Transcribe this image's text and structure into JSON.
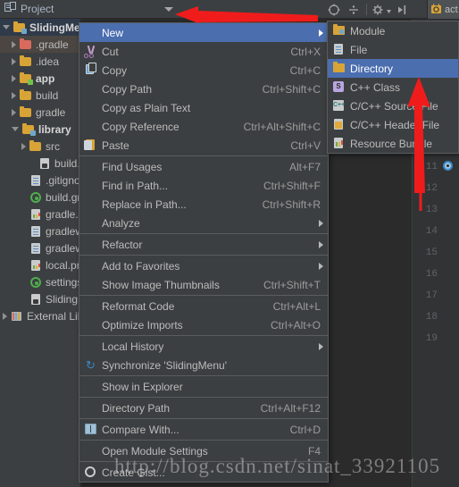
{
  "toolbar": {
    "panel_title": "Project",
    "panel_icon": "project-panel-icon",
    "dropdown_icon": "chevron-down-icon",
    "buttons": [
      {
        "name": "locate-icon",
        "glyph": "⊕"
      },
      {
        "name": "collapse-all-icon",
        "glyph": "÷"
      },
      {
        "name": "settings-gear-icon",
        "glyph": "⚙"
      },
      {
        "name": "hide-panel-icon",
        "glyph": "⇥"
      }
    ],
    "tab_label": "act"
  },
  "tree": {
    "items": [
      {
        "label": "SlidingMenu",
        "icon": "module-folder-icon",
        "twisty": "open",
        "indent": 0,
        "bold": true,
        "state": "selected"
      },
      {
        "label": ".gradle",
        "icon": "folder-red-icon",
        "twisty": "closed",
        "indent": 1,
        "bold": false,
        "state": "hover"
      },
      {
        "label": ".idea",
        "icon": "folder-orange-icon",
        "twisty": "closed",
        "indent": 1,
        "bold": false,
        "state": "none"
      },
      {
        "label": "app",
        "icon": "android-module-icon",
        "twisty": "closed",
        "indent": 1,
        "bold": true,
        "state": "none"
      },
      {
        "label": "build",
        "icon": "folder-orange-icon",
        "twisty": "closed",
        "indent": 1,
        "bold": false,
        "state": "none"
      },
      {
        "label": "gradle",
        "icon": "folder-orange-icon",
        "twisty": "closed",
        "indent": 1,
        "bold": false,
        "state": "none"
      },
      {
        "label": "library",
        "icon": "module-folder-icon",
        "twisty": "open",
        "indent": 1,
        "bold": true,
        "state": "none"
      },
      {
        "label": "src",
        "icon": "folder-orange-icon",
        "twisty": "closed",
        "indent": 2,
        "bold": false,
        "state": "none"
      },
      {
        "label": "build.gradle",
        "icon": "file-gray-icon",
        "twisty": "none",
        "indent": 3,
        "bold": false,
        "state": "none"
      },
      {
        "label": ".gitignore",
        "icon": "file-text-icon",
        "twisty": "none",
        "indent": 2,
        "bold": false,
        "state": "none"
      },
      {
        "label": "build.gradle",
        "icon": "gradle-icon",
        "twisty": "none",
        "indent": 2,
        "bold": false,
        "state": "none"
      },
      {
        "label": "gradle.properties",
        "icon": "properties-icon",
        "twisty": "none",
        "indent": 2,
        "bold": false,
        "state": "none"
      },
      {
        "label": "gradlew",
        "icon": "file-text-icon",
        "twisty": "none",
        "indent": 2,
        "bold": false,
        "state": "none"
      },
      {
        "label": "gradlew.bat",
        "icon": "file-text-icon",
        "twisty": "none",
        "indent": 2,
        "bold": false,
        "state": "none"
      },
      {
        "label": "local.properties",
        "icon": "properties-icon",
        "twisty": "none",
        "indent": 2,
        "bold": false,
        "state": "none"
      },
      {
        "label": "settings.gradle",
        "icon": "gradle-icon",
        "twisty": "none",
        "indent": 2,
        "bold": false,
        "state": "none"
      },
      {
        "label": "SlidingMenu.iml",
        "icon": "file-gray-icon",
        "twisty": "none",
        "indent": 2,
        "bold": false,
        "state": "none"
      },
      {
        "label": "External Libraries",
        "icon": "libraries-icon",
        "twisty": "closed",
        "indent": 0,
        "bold": false,
        "state": "none"
      }
    ]
  },
  "editor": {
    "line_numbers": [
      "11",
      "12",
      "13",
      "14",
      "15",
      "16",
      "17",
      "18",
      "19"
    ],
    "breakpoint_icon": "breakpoint-icon"
  },
  "context_menu": {
    "items": [
      {
        "type": "item",
        "label": "New",
        "accel": "",
        "icon": "",
        "submenu": true,
        "selected": true,
        "mnemonic": "N"
      },
      {
        "type": "item",
        "label": "Cut",
        "accel": "Ctrl+X",
        "icon": "cut-icon",
        "submenu": false,
        "selected": false,
        "mnemonic": "t"
      },
      {
        "type": "item",
        "label": "Copy",
        "accel": "Ctrl+C",
        "icon": "copy-icon",
        "submenu": false,
        "selected": false,
        "mnemonic": "C"
      },
      {
        "type": "item",
        "label": "Copy Path",
        "accel": "Ctrl+Shift+C",
        "icon": "",
        "submenu": false,
        "selected": false,
        "mnemonic": "o"
      },
      {
        "type": "item",
        "label": "Copy as Plain Text",
        "accel": "",
        "icon": "",
        "submenu": false,
        "selected": false,
        "mnemonic": ""
      },
      {
        "type": "item",
        "label": "Copy Reference",
        "accel": "Ctrl+Alt+Shift+C",
        "icon": "",
        "submenu": false,
        "selected": false,
        "mnemonic": ""
      },
      {
        "type": "item",
        "label": "Paste",
        "accel": "Ctrl+V",
        "icon": "paste-icon",
        "submenu": false,
        "selected": false,
        "mnemonic": "P"
      },
      {
        "type": "sep"
      },
      {
        "type": "item",
        "label": "Find Usages",
        "accel": "Alt+F7",
        "icon": "",
        "submenu": false,
        "selected": false,
        "mnemonic": "U"
      },
      {
        "type": "item",
        "label": "Find in Path...",
        "accel": "Ctrl+Shift+F",
        "icon": "",
        "submenu": false,
        "selected": false,
        "mnemonic": "P"
      },
      {
        "type": "item",
        "label": "Replace in Path...",
        "accel": "Ctrl+Shift+R",
        "icon": "",
        "submenu": false,
        "selected": false,
        "mnemonic": "a"
      },
      {
        "type": "item",
        "label": "Analyze",
        "accel": "",
        "icon": "",
        "submenu": true,
        "selected": false,
        "mnemonic": "z"
      },
      {
        "type": "sep"
      },
      {
        "type": "item",
        "label": "Refactor",
        "accel": "",
        "icon": "",
        "submenu": true,
        "selected": false,
        "mnemonic": "R"
      },
      {
        "type": "sep"
      },
      {
        "type": "item",
        "label": "Add to Favorites",
        "accel": "",
        "icon": "",
        "submenu": true,
        "selected": false,
        "mnemonic": "F"
      },
      {
        "type": "item",
        "label": "Show Image Thumbnails",
        "accel": "Ctrl+Shift+T",
        "icon": "",
        "submenu": false,
        "selected": false,
        "mnemonic": ""
      },
      {
        "type": "sep"
      },
      {
        "type": "item",
        "label": "Reformat Code",
        "accel": "Ctrl+Alt+L",
        "icon": "",
        "submenu": false,
        "selected": false,
        "mnemonic": "R"
      },
      {
        "type": "item",
        "label": "Optimize Imports",
        "accel": "Ctrl+Alt+O",
        "icon": "",
        "submenu": false,
        "selected": false,
        "mnemonic": "z"
      },
      {
        "type": "sep"
      },
      {
        "type": "item",
        "label": "Local History",
        "accel": "",
        "icon": "",
        "submenu": true,
        "selected": false,
        "mnemonic": "H"
      },
      {
        "type": "item",
        "label": "Synchronize 'SlidingMenu'",
        "accel": "",
        "icon": "synchronize-icon",
        "submenu": false,
        "selected": false,
        "mnemonic": ""
      },
      {
        "type": "sep"
      },
      {
        "type": "item",
        "label": "Show in Explorer",
        "accel": "",
        "icon": "",
        "submenu": false,
        "selected": false,
        "mnemonic": ""
      },
      {
        "type": "sep"
      },
      {
        "type": "item",
        "label": "Directory Path",
        "accel": "Ctrl+Alt+F12",
        "icon": "",
        "submenu": false,
        "selected": false,
        "mnemonic": "P"
      },
      {
        "type": "sep"
      },
      {
        "type": "item",
        "label": "Compare With...",
        "accel": "Ctrl+D",
        "icon": "compare-icon",
        "submenu": false,
        "selected": false,
        "mnemonic": ""
      },
      {
        "type": "sep"
      },
      {
        "type": "item",
        "label": "Open Module Settings",
        "accel": "F4",
        "icon": "",
        "submenu": false,
        "selected": false,
        "mnemonic": ""
      },
      {
        "type": "sep"
      },
      {
        "type": "item",
        "label": "Create Gist...",
        "accel": "",
        "icon": "gist-icon",
        "submenu": false,
        "selected": false,
        "mnemonic": ""
      }
    ]
  },
  "submenu": {
    "items": [
      {
        "label": "Module",
        "icon": "module-icon",
        "selected": false
      },
      {
        "label": "File",
        "icon": "file-icon",
        "selected": false
      },
      {
        "label": "Directory",
        "icon": "directory-icon",
        "selected": true
      },
      {
        "label": "C++ Class",
        "icon": "cpp-class-icon",
        "selected": false
      },
      {
        "label": "C/C++ Source File",
        "icon": "cpp-source-icon",
        "selected": false
      },
      {
        "label": "C/C++ Header File",
        "icon": "cpp-header-icon",
        "selected": false
      },
      {
        "label": "Resource Bundle",
        "icon": "resource-bundle-icon",
        "selected": false
      }
    ]
  },
  "annotations": {
    "arrow_color": "#f01c1c",
    "arrows": [
      "arrow-to-project-header",
      "arrow-to-directory-item",
      "arrow-vertical-line"
    ]
  },
  "watermark": {
    "text": "http://blog.csdn.net/sinat_33921105"
  },
  "colors": {
    "bg": "#3c3f41",
    "editor_bg": "#2b2b2b",
    "menu_bg": "#3c3f41",
    "menu_border": "#5a5c5e",
    "selection": "#4b6eaf",
    "tree_selection": "#2f3a4a",
    "text": "#bbbbbb",
    "accel_text": "#9b9b9b",
    "folder_orange": "#d9a436",
    "folder_red": "#d96a5e"
  }
}
